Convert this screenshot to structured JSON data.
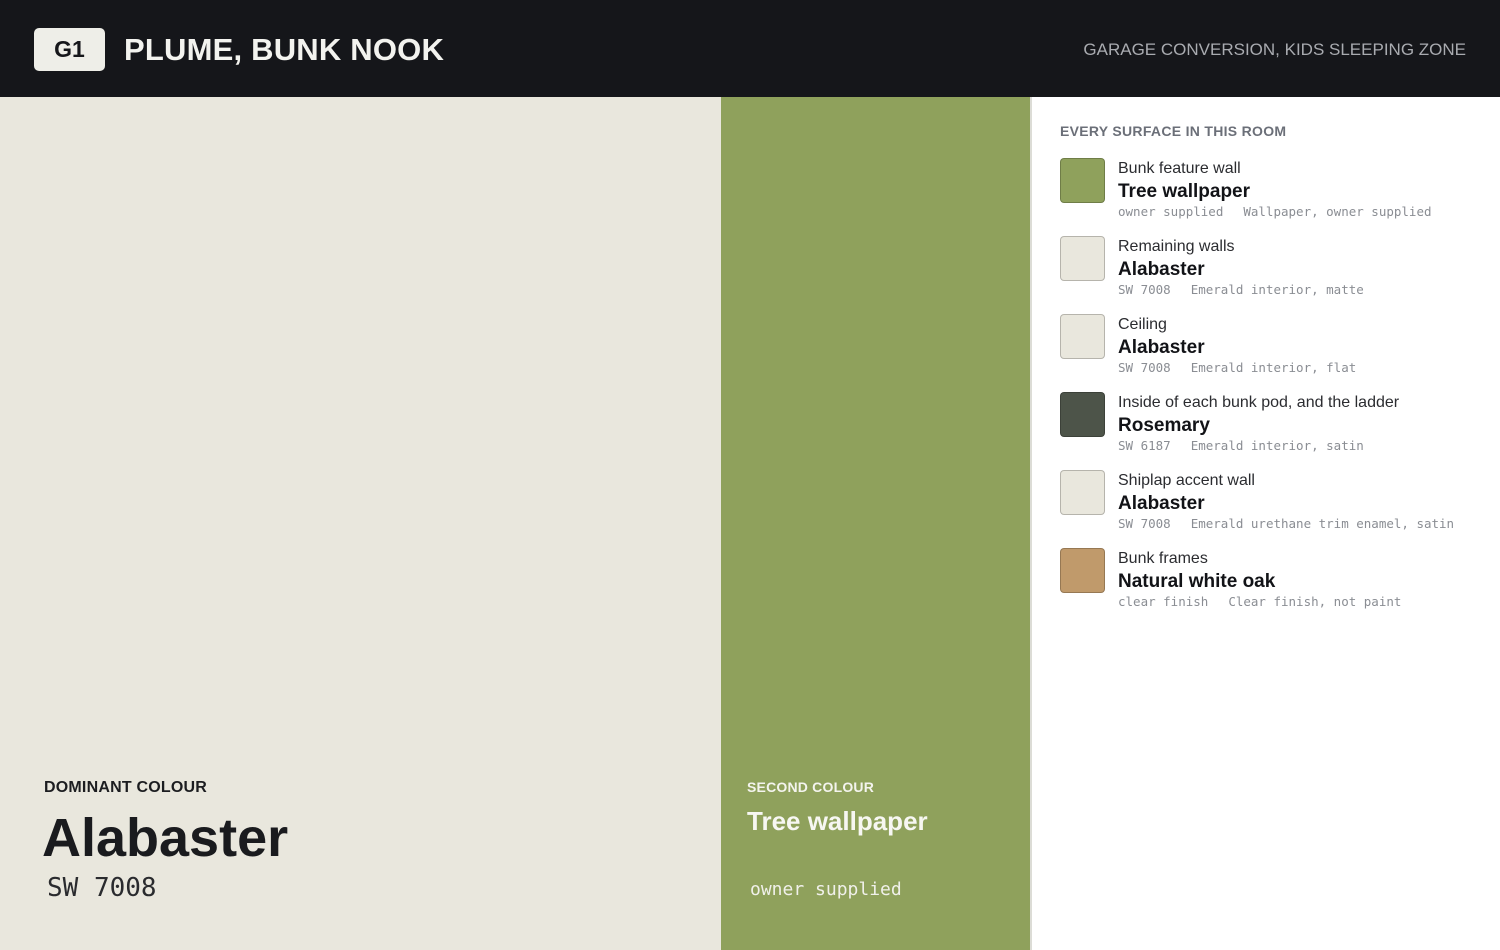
{
  "header": {
    "room_code": "G1",
    "room_title": "PLUME, BUNK NOOK",
    "room_context": "GARAGE CONVERSION, KIDS SLEEPING ZONE"
  },
  "dominant": {
    "label": "DOMINANT COLOUR",
    "name": "Alabaster",
    "code": "SW 7008",
    "color": "#e9e7dd"
  },
  "second": {
    "label": "SECOND COLOUR",
    "name": "Tree wallpaper",
    "code": "owner supplied",
    "color": "#8fa15c"
  },
  "surfaces_heading": "EVERY SURFACE IN THIS ROOM",
  "surfaces": [
    {
      "where": "Bunk feature wall",
      "colour": "Tree wallpaper",
      "code": "owner supplied",
      "finish": "Wallpaper, owner supplied",
      "color": "#8fa15c"
    },
    {
      "where": "Remaining walls",
      "colour": "Alabaster",
      "code": "SW 7008",
      "finish": "Emerald interior, matte",
      "color": "#e9e7dd"
    },
    {
      "where": "Ceiling",
      "colour": "Alabaster",
      "code": "SW 7008",
      "finish": "Emerald interior, flat",
      "color": "#e9e7dd"
    },
    {
      "where": "Inside of each bunk pod, and the ladder",
      "colour": "Rosemary",
      "code": "SW 6187",
      "finish": "Emerald interior, satin",
      "color": "#4d5449"
    },
    {
      "where": "Shiplap accent wall",
      "colour": "Alabaster",
      "code": "SW 7008",
      "finish": "Emerald urethane trim enamel, satin",
      "color": "#e9e7dd"
    },
    {
      "where": "Bunk frames",
      "colour": "Natural white oak",
      "code": "clear finish",
      "finish": "Clear finish, not paint",
      "color": "#c09a6b"
    }
  ]
}
